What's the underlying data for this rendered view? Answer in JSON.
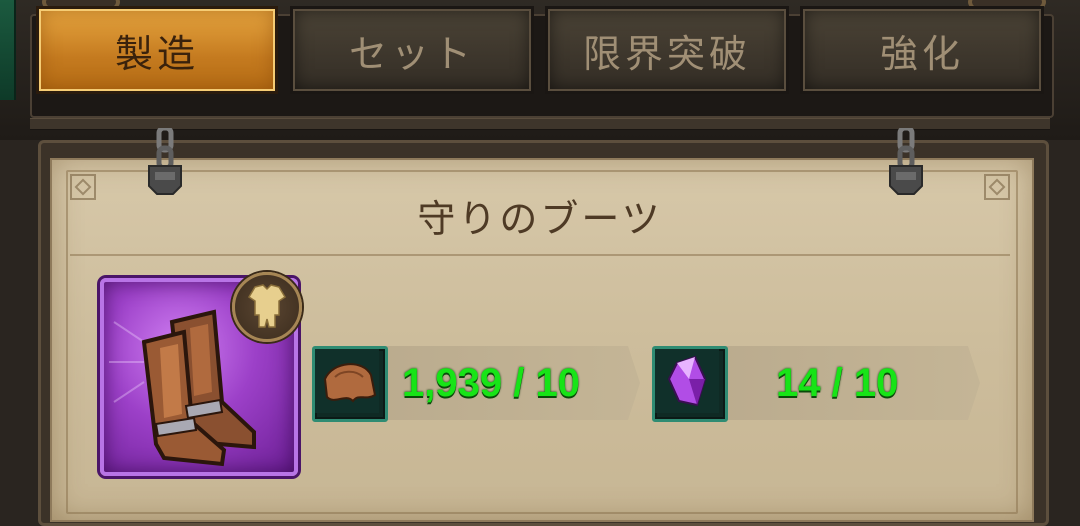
{
  "tabs": [
    {
      "label": "製造",
      "active": true
    },
    {
      "label": "セット",
      "active": false
    },
    {
      "label": "限界突破",
      "active": false
    },
    {
      "label": "強化",
      "active": false
    }
  ],
  "item": {
    "name": "守りのブーツ",
    "rarity_color": "#a94fd8",
    "type_icon": "armor-icon"
  },
  "materials": [
    {
      "icon": "leather-icon",
      "text": "1,939 / 10",
      "owned": 1939,
      "required": 10
    },
    {
      "icon": "purple-crystal-icon",
      "text": "14 / 10",
      "owned": 14,
      "required": 10
    }
  ],
  "colors": {
    "active_tab": "#d48d2c",
    "sufficient_text": "#17e417",
    "parchment": "#d2c3a3"
  }
}
